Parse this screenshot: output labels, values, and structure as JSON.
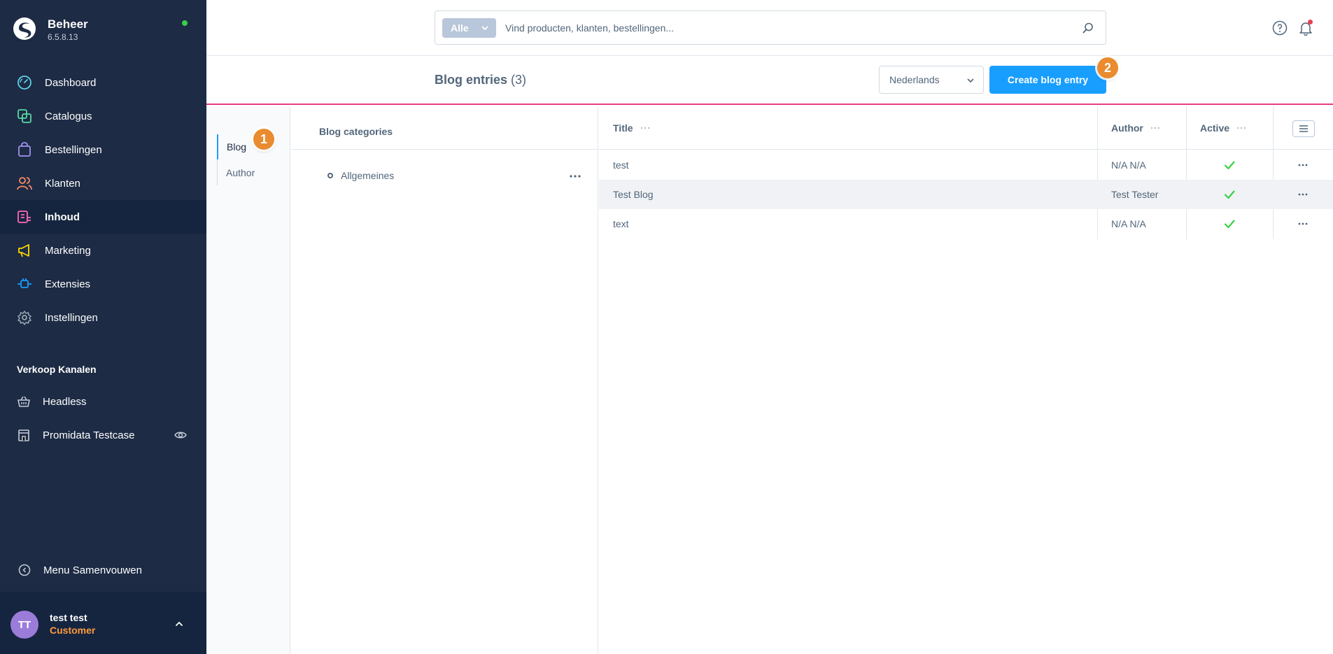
{
  "app": {
    "name": "Beheer",
    "version": "6.5.8.13",
    "status_color": "#37d046"
  },
  "sidebar": {
    "items": [
      {
        "label": "Dashboard",
        "icon": "gauge-icon",
        "color": "#5fd2e8"
      },
      {
        "label": "Catalogus",
        "icon": "catalog-icon",
        "color": "#57d9a3"
      },
      {
        "label": "Bestellingen",
        "icon": "shopping-bag-icon",
        "color": "#a092f0"
      },
      {
        "label": "Klanten",
        "icon": "users-icon",
        "color": "#f88962"
      },
      {
        "label": "Inhoud",
        "icon": "content-icon",
        "color": "#ff68b4",
        "active": true
      },
      {
        "label": "Marketing",
        "icon": "megaphone-icon",
        "color": "#ffd700"
      },
      {
        "label": "Extensies",
        "icon": "plug-icon",
        "color": "#189eff"
      },
      {
        "label": "Instellingen",
        "icon": "gear-icon",
        "color": "#9aa8b5"
      }
    ],
    "sales_channels_title": "Verkoop Kanalen",
    "sales_channels": [
      {
        "label": "Headless",
        "icon": "basket-icon"
      },
      {
        "label": "Promidata Testcase",
        "icon": "storefront-icon"
      }
    ],
    "collapse_label": "Menu Samenvouwen",
    "user": {
      "initials": "TT",
      "name": "test test",
      "role": "Customer"
    }
  },
  "topbar": {
    "search_filter": "Alle",
    "search_placeholder": "Vind producten, klanten, bestellingen..."
  },
  "smartbar": {
    "title": "Blog entries",
    "count": "(3)",
    "language": "Nederlands",
    "create_label": "Create blog entry"
  },
  "markers": {
    "one": "1",
    "two": "2"
  },
  "left_nav": {
    "items": [
      {
        "label": "Blog",
        "active": true
      },
      {
        "label": "Author"
      }
    ]
  },
  "categories": {
    "title": "Blog categories",
    "items": [
      "Allgemeines"
    ]
  },
  "grid": {
    "columns": [
      "Title",
      "Author",
      "Active"
    ],
    "rows": [
      {
        "title": "test",
        "author": "N/A N/A",
        "active": true
      },
      {
        "title": "Test Blog",
        "author": "Test Tester",
        "active": true
      },
      {
        "title": "text",
        "author": "N/A N/A",
        "active": true
      }
    ]
  },
  "colors": {
    "accent": "#189eff",
    "sidebar_bg": "#1d2b45",
    "highlight_line": "#e83b84",
    "marker": "#e98b2e",
    "check": "#37d046"
  }
}
